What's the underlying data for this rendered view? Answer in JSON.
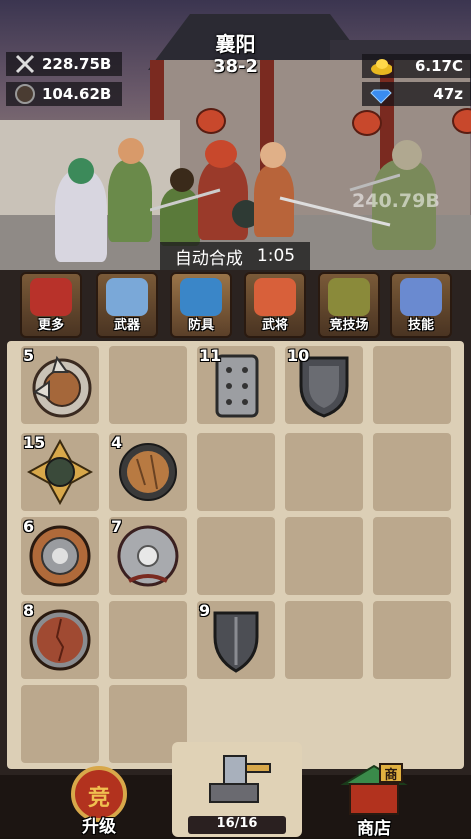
{
  "header": {
    "location": "襄阳",
    "stage": "38-2"
  },
  "resources": {
    "attack": {
      "icon": "crossed-swords-icon",
      "value": "228.75B"
    },
    "defense": {
      "icon": "shield-round-icon",
      "value": "104.62B"
    },
    "gold": {
      "icon": "gold-ingot-icon",
      "value": "6.17C"
    },
    "gems": {
      "icon": "diamond-icon",
      "value": "47z"
    }
  },
  "battle": {
    "damage_text": "240.79B",
    "auto_merge_label": "自动合成",
    "auto_merge_timer": "1:05"
  },
  "tabs": [
    {
      "label": "更多",
      "icon": "scroll-icon"
    },
    {
      "label": "武器",
      "icon": "axe-icon"
    },
    {
      "label": "防具",
      "icon": "helmet-icon"
    },
    {
      "label": "武将",
      "icon": "general-icon"
    },
    {
      "label": "竞技场",
      "icon": "lion-icon"
    },
    {
      "label": "技能",
      "icon": "hammer-icon"
    }
  ],
  "grid": {
    "items": [
      {
        "level": "5",
        "kind": "spiked-wooden-shield"
      },
      {
        "level": "11",
        "kind": "riveted-iron-shield"
      },
      {
        "level": "10",
        "kind": "dark-steel-shield"
      },
      {
        "level": "15",
        "kind": "golden-spiked-orb-shield"
      },
      {
        "level": "4",
        "kind": "spiked-round-shield"
      },
      {
        "level": "6",
        "kind": "studded-round-shield"
      },
      {
        "level": "7",
        "kind": "crescent-shield"
      },
      {
        "level": "8",
        "kind": "cracked-wooden-shield"
      },
      {
        "level": "9",
        "kind": "dark-kite-shield"
      }
    ]
  },
  "bottom": {
    "upgrade_label": "升级",
    "upgrade_emblem": "竞",
    "forge_count": "16/16",
    "shop_label": "商店",
    "shop_sign": "商"
  },
  "colors": {
    "board": "#dccfb6",
    "cell": "#bba88d",
    "tab_bg": "#5b4029"
  }
}
